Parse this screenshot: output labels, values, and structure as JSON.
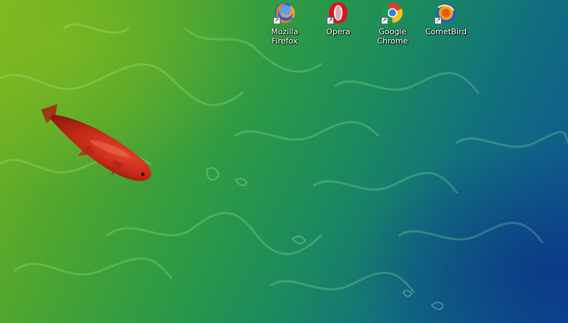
{
  "desktop": {
    "icons": [
      {
        "label": "Mozilla Firefox",
        "icon": "firefox-icon"
      },
      {
        "label": "Opera",
        "icon": "opera-icon"
      },
      {
        "label": "Google Chrome",
        "icon": "chrome-icon"
      },
      {
        "label": "CometBird",
        "icon": "cometbird-icon"
      }
    ],
    "shortcut_arrow": "↗",
    "wallpaper": "koi-fish-water"
  }
}
